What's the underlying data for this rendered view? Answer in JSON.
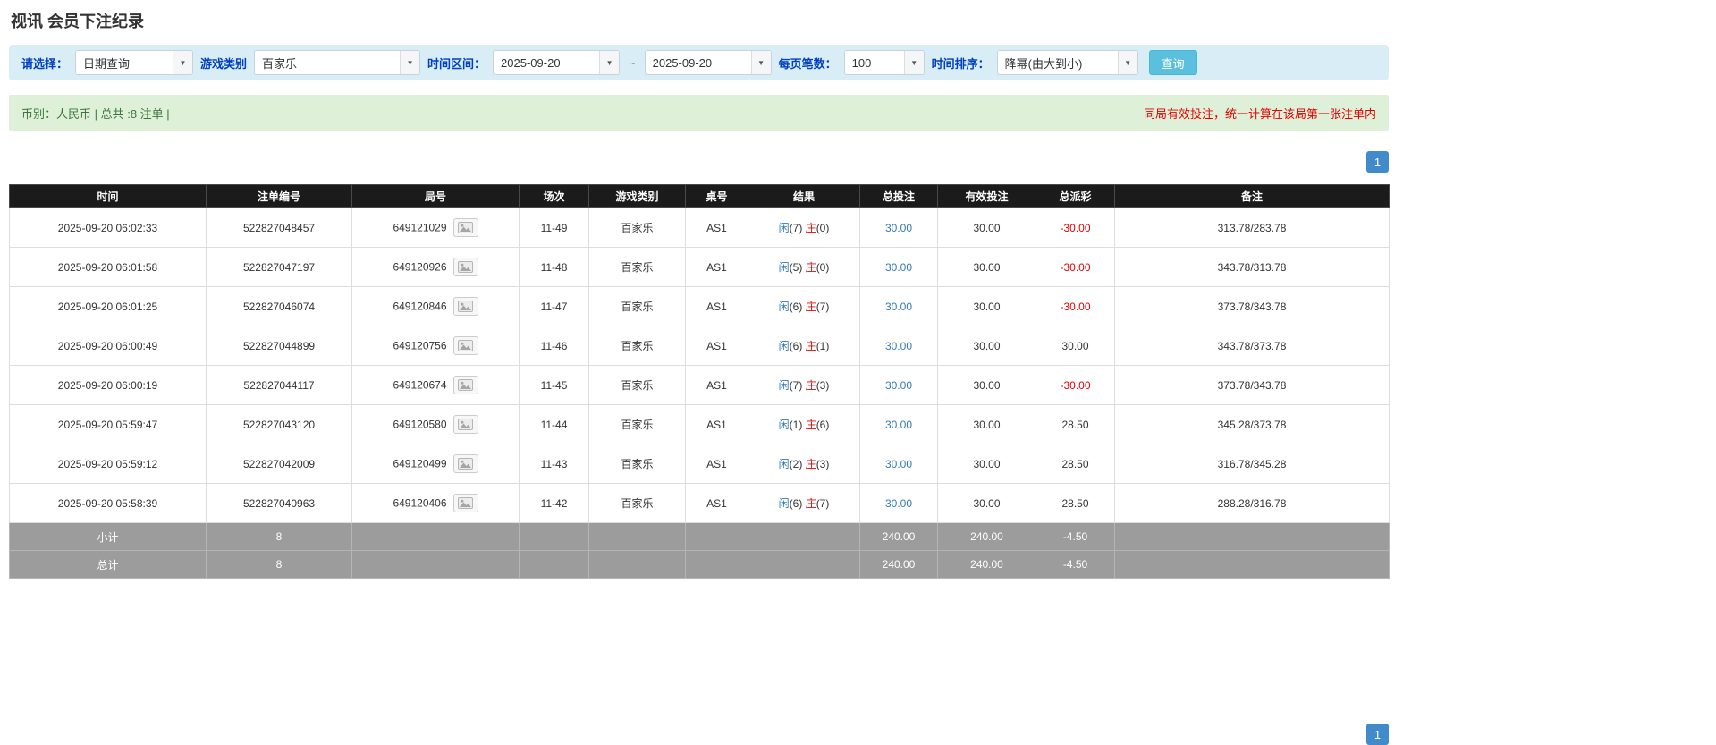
{
  "page": {
    "title": "视讯 会员下注纪录"
  },
  "colors": {
    "accent_blue": "#337ab7",
    "red": "#e60000",
    "label_blue": "#0040c0",
    "header_bg": "#1b1b1b",
    "footer_bg": "#9c9c9c",
    "filter_bar_bg": "#d9edf7",
    "summary_bar_bg": "#dff0d8",
    "search_button_bg": "#5bc0de",
    "pagination_bg": "#428bca"
  },
  "icons": {
    "combo_arrow": "chevron-down-icon",
    "replay": "video-replay-icon"
  },
  "filters": {
    "select_label": "请选择：",
    "select_value": "日期查询",
    "game_type_label": "游戏类别",
    "game_type_value": "百家乐",
    "time_range_label": "时间区间：",
    "date_from": "2025-09-20",
    "tilde": "~",
    "date_to": "2025-09-20",
    "page_size_label": "每页笔数：",
    "page_size_value": "100",
    "sort_label": "时间排序：",
    "sort_value": "降幂(由大到小)",
    "search_button": "查询"
  },
  "summary": {
    "left": "币别：人民币 | 总共 :8 注单 |",
    "right": "同局有效投注，统一计算在该局第一张注单内"
  },
  "pagination": {
    "page": "1"
  },
  "table": {
    "headers": [
      "时间",
      "注单编号",
      "局号",
      "场次",
      "游戏类别",
      "桌号",
      "结果",
      "总投注",
      "有效投注",
      "总派彩",
      "备注"
    ],
    "rows": [
      {
        "time": "2025-09-20 06:02:33",
        "bet_id": "522827048457",
        "round_id": "649121029",
        "session": "11-49",
        "game": "百家乐",
        "table_no": "AS1",
        "player_label": "闲",
        "player_score": "(7)",
        "banker_label": "庄",
        "banker_score": "(0)",
        "total_bet": "30.00",
        "valid_bet": "30.00",
        "payout": "-30.00",
        "note": "313.78/283.78"
      },
      {
        "time": "2025-09-20 06:01:58",
        "bet_id": "522827047197",
        "round_id": "649120926",
        "session": "11-48",
        "game": "百家乐",
        "table_no": "AS1",
        "player_label": "闲",
        "player_score": "(5)",
        "banker_label": "庄",
        "banker_score": "(0)",
        "total_bet": "30.00",
        "valid_bet": "30.00",
        "payout": "-30.00",
        "note": "343.78/313.78"
      },
      {
        "time": "2025-09-20 06:01:25",
        "bet_id": "522827046074",
        "round_id": "649120846",
        "session": "11-47",
        "game": "百家乐",
        "table_no": "AS1",
        "player_label": "闲",
        "player_score": "(6)",
        "banker_label": "庄",
        "banker_score": "(7)",
        "total_bet": "30.00",
        "valid_bet": "30.00",
        "payout": "-30.00",
        "note": "373.78/343.78"
      },
      {
        "time": "2025-09-20 06:00:49",
        "bet_id": "522827044899",
        "round_id": "649120756",
        "session": "11-46",
        "game": "百家乐",
        "table_no": "AS1",
        "player_label": "闲",
        "player_score": "(6)",
        "banker_label": "庄",
        "banker_score": "(1)",
        "total_bet": "30.00",
        "valid_bet": "30.00",
        "payout": "30.00",
        "note": "343.78/373.78"
      },
      {
        "time": "2025-09-20 06:00:19",
        "bet_id": "522827044117",
        "round_id": "649120674",
        "session": "11-45",
        "game": "百家乐",
        "table_no": "AS1",
        "player_label": "闲",
        "player_score": "(7)",
        "banker_label": "庄",
        "banker_score": "(3)",
        "total_bet": "30.00",
        "valid_bet": "30.00",
        "payout": "-30.00",
        "note": "373.78/343.78"
      },
      {
        "time": "2025-09-20 05:59:47",
        "bet_id": "522827043120",
        "round_id": "649120580",
        "session": "11-44",
        "game": "百家乐",
        "table_no": "AS1",
        "player_label": "闲",
        "player_score": "(1)",
        "banker_label": "庄",
        "banker_score": "(6)",
        "total_bet": "30.00",
        "valid_bet": "30.00",
        "payout": "28.50",
        "note": "345.28/373.78"
      },
      {
        "time": "2025-09-20 05:59:12",
        "bet_id": "522827042009",
        "round_id": "649120499",
        "session": "11-43",
        "game": "百家乐",
        "table_no": "AS1",
        "player_label": "闲",
        "player_score": "(2)",
        "banker_label": "庄",
        "banker_score": "(3)",
        "total_bet": "30.00",
        "valid_bet": "30.00",
        "payout": "28.50",
        "note": "316.78/345.28"
      },
      {
        "time": "2025-09-20 05:58:39",
        "bet_id": "522827040963",
        "round_id": "649120406",
        "session": "11-42",
        "game": "百家乐",
        "table_no": "AS1",
        "player_label": "闲",
        "player_score": "(6)",
        "banker_label": "庄",
        "banker_score": "(7)",
        "total_bet": "30.00",
        "valid_bet": "30.00",
        "payout": "28.50",
        "note": "288.28/316.78"
      }
    ],
    "subtotal": {
      "label": "小计",
      "count": "8",
      "total_bet": "240.00",
      "valid_bet": "240.00",
      "payout": "-4.50"
    },
    "total": {
      "label": "总计",
      "count": "8",
      "total_bet": "240.00",
      "valid_bet": "240.00",
      "payout": "-4.50"
    }
  }
}
